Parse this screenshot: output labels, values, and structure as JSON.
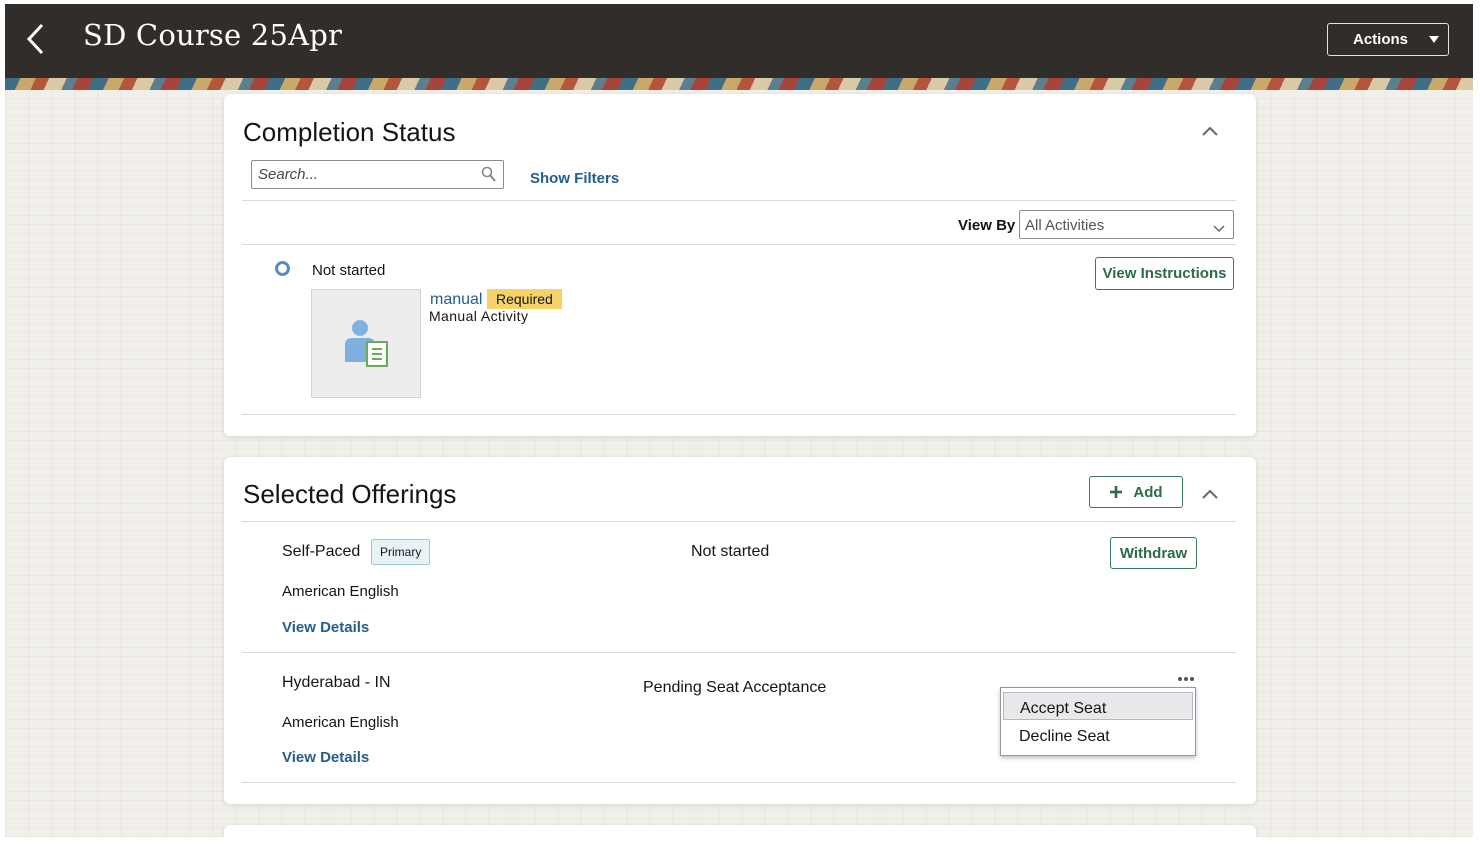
{
  "header": {
    "title": "SD Course 25Apr",
    "actions_label": "Actions"
  },
  "completion": {
    "title": "Completion Status",
    "search_placeholder": "Search...",
    "show_filters": "Show Filters",
    "view_by_label": "View By",
    "view_by_value": "All Activities",
    "activity": {
      "status": "Not started",
      "name": "manual",
      "badge": "Required",
      "type": "Manual Activity",
      "view_instructions": "View Instructions"
    }
  },
  "offerings": {
    "title": "Selected Offerings",
    "add_label": "Add",
    "items": [
      {
        "name": "Self-Paced",
        "badge": "Primary",
        "status": "Not started",
        "language": "American English",
        "details_link": "View Details",
        "action": "Withdraw"
      },
      {
        "name": "Hyderabad - IN",
        "status": "Pending Seat Acceptance",
        "language": "American English",
        "details_link": "View Details"
      }
    ],
    "menu": [
      "Accept Seat",
      "Decline Seat"
    ]
  },
  "colors": {
    "header_bg": "#312d2a",
    "link": "#22608f",
    "required_badge": "#f5d26a",
    "button_outline": "#3a7a55",
    "status_ring": "#5b8cc1"
  },
  "icons": [
    "back-arrow-icon",
    "caret-down-icon",
    "search-icon",
    "chevron-up-icon",
    "chevron-down-icon",
    "plus-icon",
    "more-options-icon",
    "manual-activity-icon"
  ]
}
